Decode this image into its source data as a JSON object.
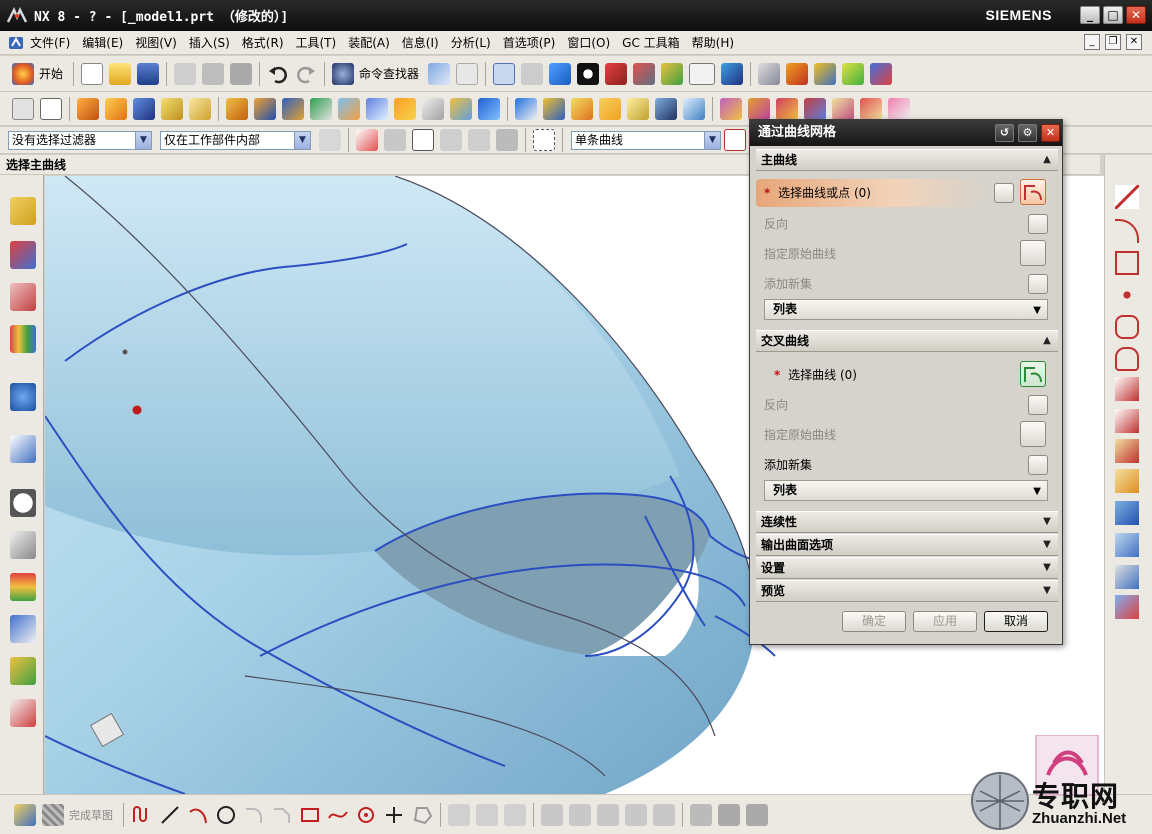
{
  "window": {
    "title": "NX 8 - ? - [_model1.prt （修改的）]",
    "brand": "SIEMENS",
    "controls": {
      "minimize": "_",
      "maximize": "□",
      "close": "✕"
    }
  },
  "menu": {
    "items": [
      "文件(F)",
      "编辑(E)",
      "视图(V)",
      "插入(S)",
      "格式(R)",
      "工具(T)",
      "装配(A)",
      "信息(I)",
      "分析(L)",
      "首选项(P)",
      "窗口(O)",
      "GC 工具箱",
      "帮助(H)"
    ]
  },
  "toolbar1": {
    "start_label": "开始",
    "command_finder_label": "命令查找器"
  },
  "selection_bar": {
    "filter_value": "没有选择过滤器",
    "scope_value": "仅在工作部件内部",
    "curve_rule_value": "单条曲线"
  },
  "cue_line": "选择主曲线",
  "bottom_toolbar": {
    "finish_sketch_label": "完成草图"
  },
  "dialog": {
    "title": "通过曲线网格",
    "primary": {
      "header": "主曲线",
      "select_label": "选择曲线或点",
      "select_count": "(0)",
      "reverse_label": "反向",
      "specify_origin_label": "指定原始曲线",
      "add_new_label": "添加新集",
      "list_label": "列表"
    },
    "cross": {
      "header": "交叉曲线",
      "select_label": "选择曲线",
      "select_count": "(0)",
      "reverse_label": "反向",
      "specify_origin_label": "指定原始曲线",
      "add_new_label": "添加新集",
      "list_label": "列表"
    },
    "collapsed_sections": [
      "连续性",
      "输出曲面选项",
      "设置",
      "预览"
    ],
    "buttons": {
      "ok": "确定",
      "apply": "应用",
      "cancel": "取消"
    }
  },
  "watermark": {
    "site_name": "专职网",
    "site_url": "Zhuanzhi.Net"
  },
  "colors": {
    "title_bar": "#151515",
    "surface": "#a9d3e8",
    "curve": "#2b4fc0",
    "active_row": "#e7a77a",
    "close_button": "#c0301a"
  }
}
